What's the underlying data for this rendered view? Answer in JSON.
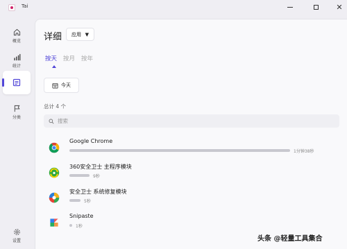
{
  "window": {
    "title": "Tai",
    "controls": {
      "minimize": "minimize-icon",
      "maximize": "maximize-icon",
      "close": "✕"
    }
  },
  "nav": {
    "items": [
      {
        "label": "概览",
        "icon": "home-icon"
      },
      {
        "label": "统计",
        "icon": "bar-chart-icon"
      },
      {
        "label": "",
        "icon": "list-detail-icon",
        "active": true
      },
      {
        "label": "分类",
        "icon": "flag-icon"
      }
    ],
    "settings": {
      "label": "设置",
      "icon": "gear-icon"
    }
  },
  "header": {
    "title": "详细",
    "app_select": "应用",
    "caret": "▼"
  },
  "tabs": [
    "按天",
    "按月",
    "按年"
  ],
  "today_button": "今天",
  "total": "总计 4 个",
  "search": {
    "placeholder": "搜索"
  },
  "apps": [
    {
      "name": "Google Chrome",
      "duration": "1分钟38秒",
      "fraction": 1.0,
      "icon": "chrome-icon",
      "dur_prefix": ""
    },
    {
      "name": "360安全卫士 主程序模块",
      "duration": "9秒",
      "fraction": 0.092,
      "icon": "360-safeguard-icon",
      "dur_prefix": ""
    },
    {
      "name": "安全卫士 系统修复模块",
      "duration": "5秒",
      "fraction": 0.051,
      "icon": "system-repair-icon",
      "dur_prefix": ""
    },
    {
      "name": "Snipaste",
      "duration": "1秒",
      "fraction": 0.01,
      "icon": "snipaste-icon",
      "dur_prefix": ""
    }
  ],
  "watermark": "头条 @轻量工具集合",
  "colors": {
    "accent": "#5146d8",
    "bar": "#c8c8cf",
    "background": "#efeef3",
    "panel": "#f9f9fb"
  }
}
